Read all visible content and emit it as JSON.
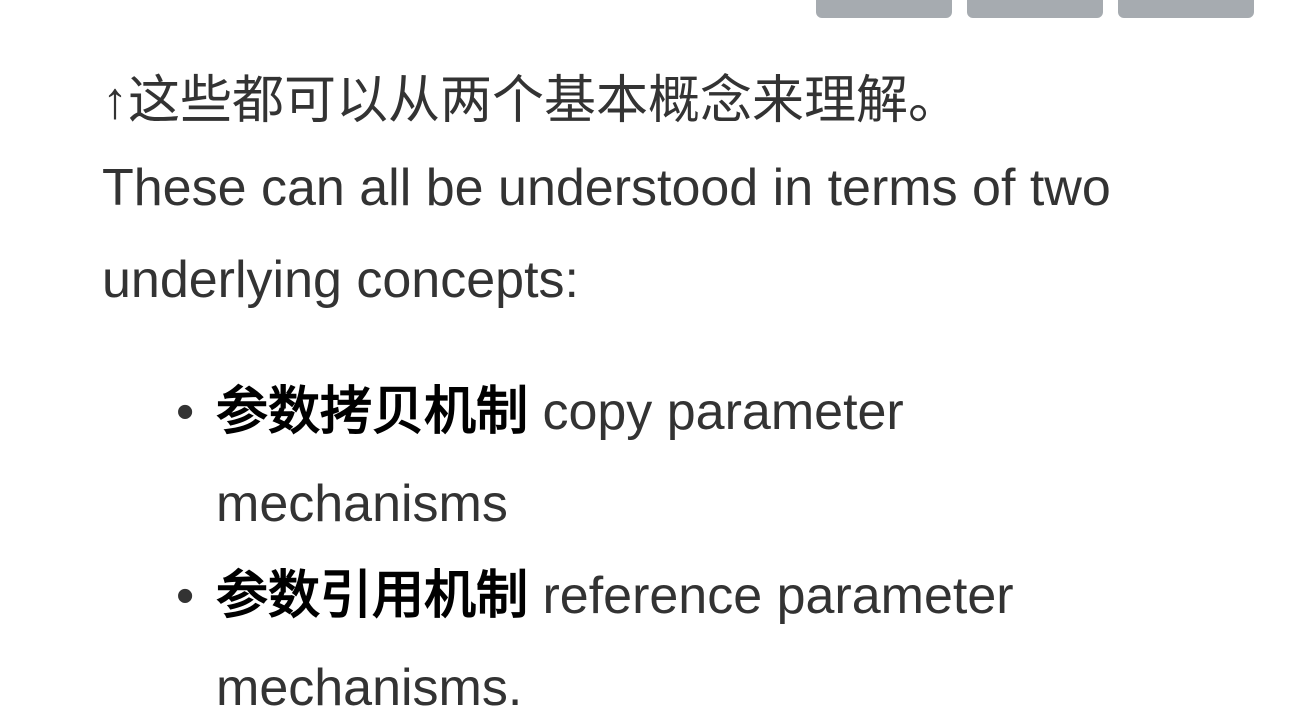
{
  "toolbar": {
    "buttons": [
      "",
      "",
      ""
    ]
  },
  "content": {
    "zh_line": "↑这些都可以从两个基本概念来理解。",
    "en_paragraph": "These can all be understood in terms of two underlying concepts:",
    "list_items": [
      {
        "bold": "参数拷贝机制",
        "text": " copy parameter mechanisms"
      },
      {
        "bold": "参数引用机制",
        "text": " reference parameter mechanisms."
      }
    ]
  },
  "colors": {
    "text": "#333333",
    "bold_text": "#000000",
    "button": "#a6abb0",
    "background": "#ffffff"
  }
}
